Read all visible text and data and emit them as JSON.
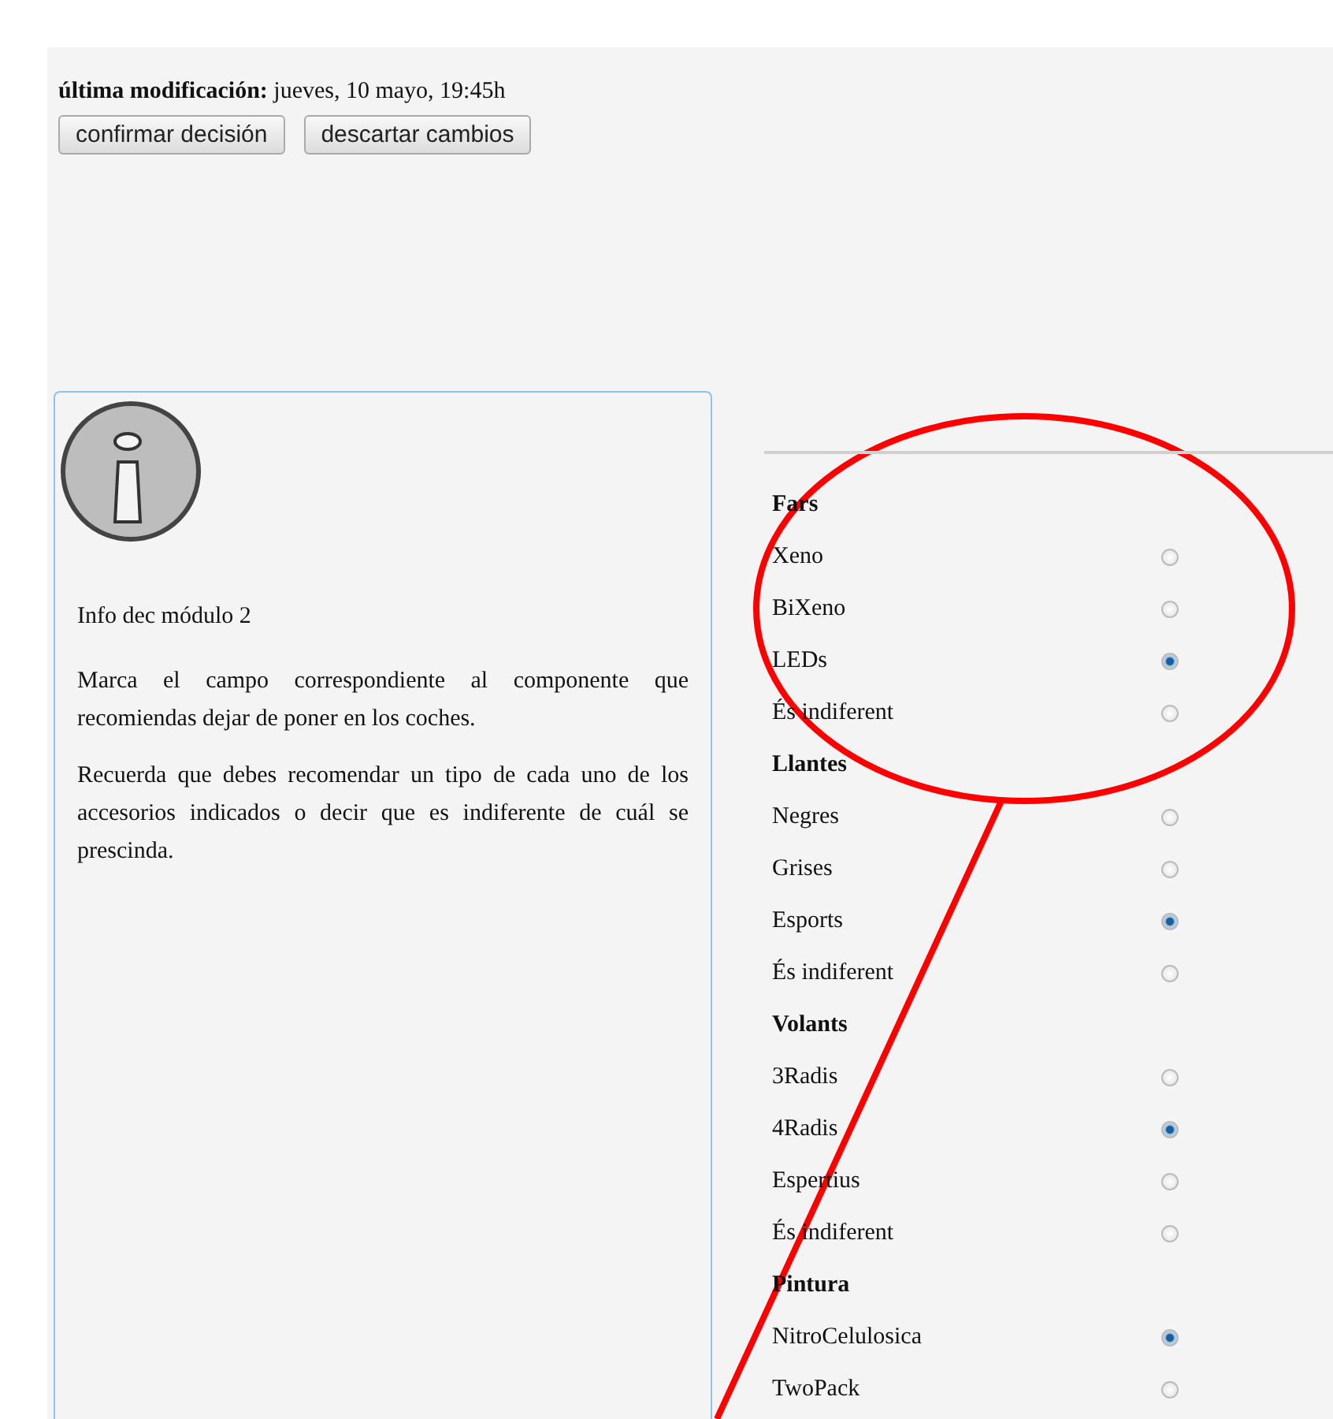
{
  "last_modified": {
    "label": "última modificación:",
    "value": "jueves, 10 mayo, 19:45h"
  },
  "buttons": [
    "confirmar decisión",
    "descartar cambios"
  ],
  "info_panel": {
    "title": "Info dec módulo 2",
    "paragraphs": [
      "Marca el campo correspondiente al componente que recomiendas dejar de poner en los coches.",
      "Recuerda que debes recomendar un tipo de cada uno de los accesorios indicados o decir que es indiferente de cuál se prescinda."
    ]
  },
  "groups": [
    {
      "title": "Fars",
      "options": [
        {
          "label": "Xeno",
          "selected": false
        },
        {
          "label": "BiXeno",
          "selected": false
        },
        {
          "label": "LEDs",
          "selected": true
        },
        {
          "label": "És indiferent",
          "selected": false
        }
      ]
    },
    {
      "title": "Llantes",
      "options": [
        {
          "label": "Negres",
          "selected": false
        },
        {
          "label": "Grises",
          "selected": false
        },
        {
          "label": "Esports",
          "selected": true
        },
        {
          "label": "És indiferent",
          "selected": false
        }
      ]
    },
    {
      "title": "Volants",
      "options": [
        {
          "label": "3Radis",
          "selected": false
        },
        {
          "label": "4Radis",
          "selected": true
        },
        {
          "label": "Espertius",
          "selected": false
        },
        {
          "label": "És indiferent",
          "selected": false
        }
      ]
    },
    {
      "title": "Pintura",
      "options": [
        {
          "label": "NitroCelulosica",
          "selected": true
        },
        {
          "label": "TwoPack",
          "selected": false
        }
      ]
    }
  ]
}
